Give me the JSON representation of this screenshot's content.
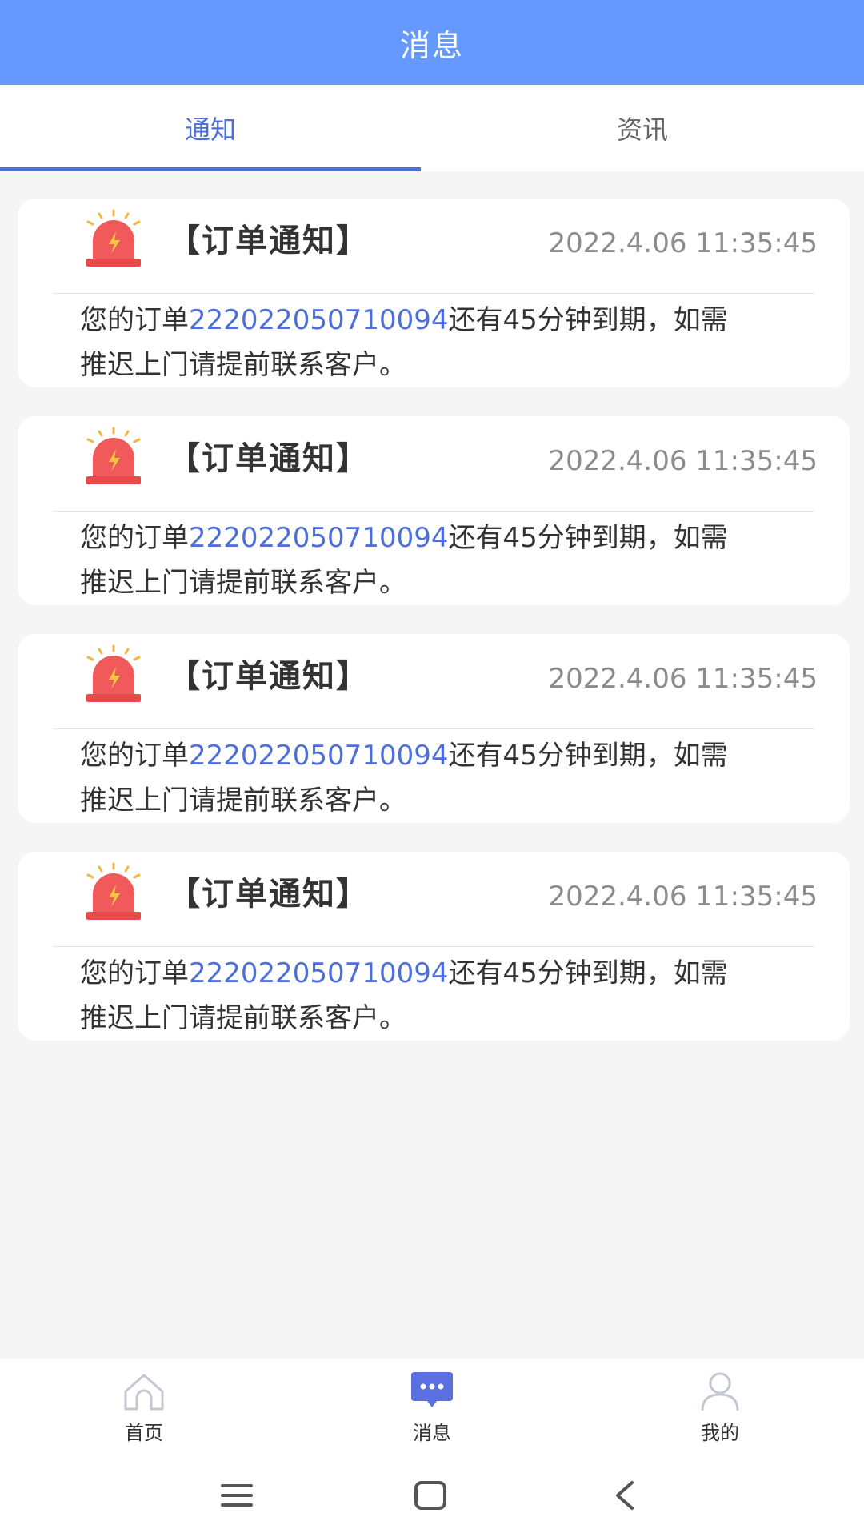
{
  "header": {
    "title": "消息"
  },
  "tabs": [
    {
      "label": "通知",
      "active": true
    },
    {
      "label": "资讯",
      "active": false
    }
  ],
  "colors": {
    "header_bg": "#6699ff",
    "accent": "#4e6fd8",
    "alarm_red": "#f05a5a",
    "page_bg": "#f5f5f5"
  },
  "notifications": [
    {
      "icon": "alarm-light-icon",
      "title": "【订单通知】",
      "time": "2022.4.06 11:35:45",
      "prefix": "您的订单",
      "order_no": "22202205071009­4",
      "suffix": "还有45分钟到期，如需推迟上门请提前联系客户。"
    },
    {
      "icon": "alarm-light-icon",
      "title": "【订单通知】",
      "time": "2022.4.06 11:35:45",
      "prefix": "您的订单",
      "order_no": "22202205071009­4",
      "suffix": "还有45分钟到期，如需推迟上门请提前联系客户。"
    },
    {
      "icon": "alarm-light-icon",
      "title": "【订单通知】",
      "time": "2022.4.06 11:35:45",
      "prefix": "您的订单",
      "order_no": "22202205071009­4",
      "suffix": "还有45分钟到期，如需推迟上门请提前联系客户。"
    },
    {
      "icon": "alarm-light-icon",
      "title": "【订单通知】",
      "time": "2022.4.06 11:35:45",
      "prefix": "您的订单",
      "order_no": "22202205071009­4",
      "suffix": "还有45分钟到期，如需推迟上门请提前联系客户。"
    }
  ],
  "bottom_nav": [
    {
      "label": "首页",
      "icon": "home-icon",
      "active": false
    },
    {
      "label": "消息",
      "icon": "message-icon",
      "active": true
    },
    {
      "label": "我的",
      "icon": "user-icon",
      "active": false
    }
  ],
  "system_nav": [
    "menu-icon",
    "home-square-icon",
    "back-icon"
  ]
}
